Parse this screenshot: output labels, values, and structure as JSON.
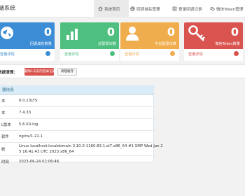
{
  "app": {
    "title": "端系统"
  },
  "nav": {
    "items": [
      {
        "label": "系统首页",
        "icon": "home-icon",
        "active": true
      },
      {
        "label": "回调域名管理",
        "icon": "globe-icon",
        "active": false
      },
      {
        "label": "登录回调记录",
        "icon": "list-icon",
        "active": false
      },
      {
        "label": "微信Token管理",
        "icon": "wechat-icon",
        "active": false
      }
    ]
  },
  "cards": [
    {
      "value": "0",
      "label": "回调域名数量",
      "footer": "查看详情",
      "color": "#3c8dd5",
      "icon": "globe-icon"
    },
    {
      "value": "0",
      "label": "总登录次数",
      "footer": "查看详情",
      "color": "#4fbf80",
      "icon": "bar-chart-icon"
    },
    {
      "value": "0",
      "label": "今日登录次数",
      "footer": "查看详情",
      "color": "#f0ad4e",
      "icon": "user-icon"
    },
    {
      "value": "0",
      "label": "微信Token数量",
      "footer": "查看详情",
      "color": "#d9534f",
      "icon": "key-icon"
    }
  ],
  "cleanup": {
    "title": "数据清理：",
    "delete_label": "删除1天前的登录记录",
    "optimize_label": "清理缓存"
  },
  "info": {
    "title": "器信息",
    "rows": [
      {
        "key": "本",
        "value": "6.0.13LTS"
      },
      {
        "key": "本",
        "value": "7.4.33"
      },
      {
        "key": "L版本",
        "value": "5.6.50-log"
      },
      {
        "key": "软件",
        "value": "nginx/1.22.1"
      },
      {
        "key": "统",
        "value": "Linux localhost.localdomain 3.10.0-1160.83.1.el7.x86_64 #1 SMP Wed Jan 2",
        "value2": "5 16:41:43 UTC 2023 x86_64"
      },
      {
        "key": "时间",
        "value": "2023-06-24 02:06:46"
      }
    ]
  }
}
